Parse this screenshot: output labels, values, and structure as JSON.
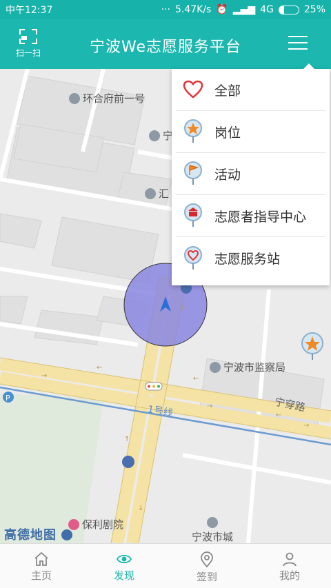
{
  "status": {
    "time": "中午12:37",
    "speed": "5.47K/s",
    "network": "4G",
    "battery": "25%",
    "battery_level": 0.25
  },
  "header": {
    "scan_label": "扫一扫",
    "title": "宁波We志愿服务平台"
  },
  "map": {
    "pois": [
      "环合府前一号",
      "宁",
      "汇",
      "宁波市监察局",
      "保利剧院",
      "宁波市城"
    ],
    "road": "宁穿路",
    "metro": "1号线",
    "logo": "高德地图"
  },
  "dropdown": {
    "items": [
      {
        "label": "全部",
        "icon": "heart-outline-icon"
      },
      {
        "label": "岗位",
        "icon": "star-pin-icon"
      },
      {
        "label": "活动",
        "icon": "flag-pin-icon"
      },
      {
        "label": "志愿者指导中心",
        "icon": "building-pin-icon"
      },
      {
        "label": "志愿服务站",
        "icon": "heart-pin-icon"
      }
    ]
  },
  "tabs": [
    {
      "label": "主页",
      "icon": "home-icon"
    },
    {
      "label": "发现",
      "icon": "eye-icon",
      "active": true
    },
    {
      "label": "签到",
      "icon": "location-icon"
    },
    {
      "label": "我的",
      "icon": "user-icon"
    }
  ],
  "colors": {
    "primary": "#1cb7ae",
    "location_circle": "#8a86e0"
  }
}
